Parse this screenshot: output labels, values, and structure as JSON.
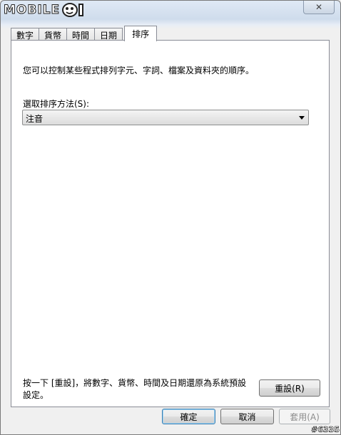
{
  "logo_text": "MOBILE",
  "window": {
    "close_label": "✕"
  },
  "tabs": [
    {
      "label": "數字"
    },
    {
      "label": "貨幣"
    },
    {
      "label": "時間"
    },
    {
      "label": "日期"
    },
    {
      "label": "排序",
      "active": true
    }
  ],
  "sort": {
    "description": "您可以控制某些程式排列字元、字詞、檔案及資料夾的順序。",
    "method_label": "選取排序方法(S):",
    "method_value": "注音"
  },
  "reset": {
    "text": "按一下 [重設]，將數字、貨幣、時間及日期還原為系統預設設定。",
    "button_label": "重設(R)"
  },
  "footer": {
    "ok_label": "確定",
    "cancel_label": "取消",
    "apply_label": "套用(A)"
  },
  "watermark": "#6335"
}
